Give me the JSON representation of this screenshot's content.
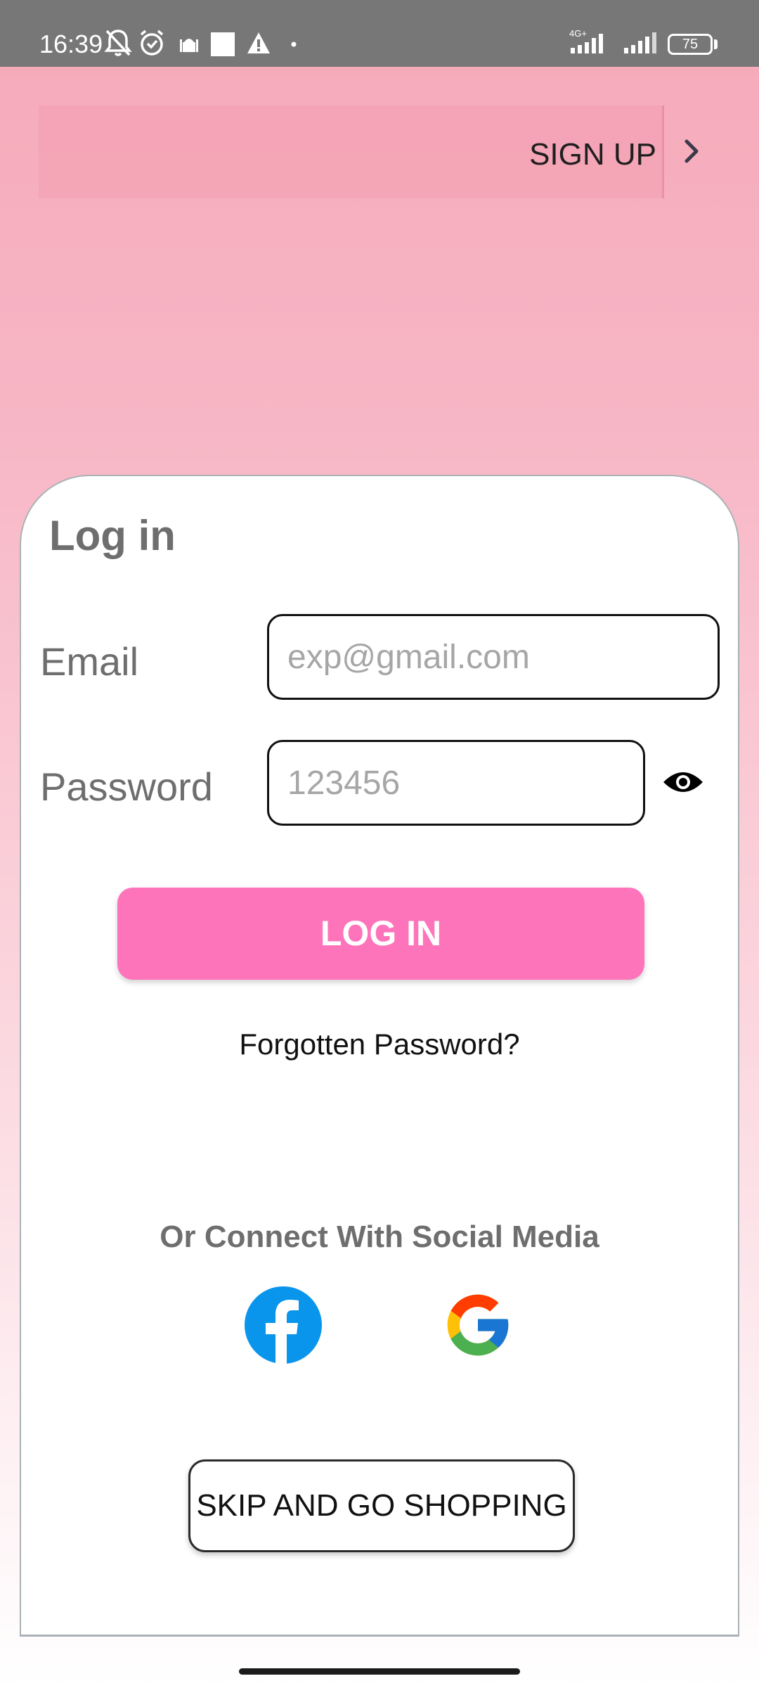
{
  "status_bar": {
    "time": "16:39",
    "battery": "75",
    "network": "4G+",
    "icons": [
      "bell-off-icon",
      "alarm-icon",
      "mosque-icon",
      "square-notification-icon",
      "warning-icon",
      "dot-icon",
      "signal-icon",
      "battery-icon"
    ]
  },
  "header": {
    "sign_up_label": "SIGN UP"
  },
  "login_card": {
    "title": "Log in",
    "email": {
      "label": "Email",
      "value": "",
      "placeholder": "exp@gmail.com"
    },
    "password": {
      "label": "Password",
      "value": "",
      "placeholder": "123456"
    },
    "login_button_label": "LOG IN",
    "forgot_password_label": "Forgotten Password?",
    "social_heading": "Or Connect With Social Media",
    "social_providers": [
      "facebook-icon",
      "google-icon"
    ],
    "skip_button_label": "SKIP AND GO SHOPPING"
  },
  "colors": {
    "status_bar_bg": "#777777",
    "background_top": "#f6a9b9",
    "login_button_bg": "#fe74bb",
    "facebook_blue": "#0a95ec",
    "label_gray": "#6e6e6e"
  }
}
